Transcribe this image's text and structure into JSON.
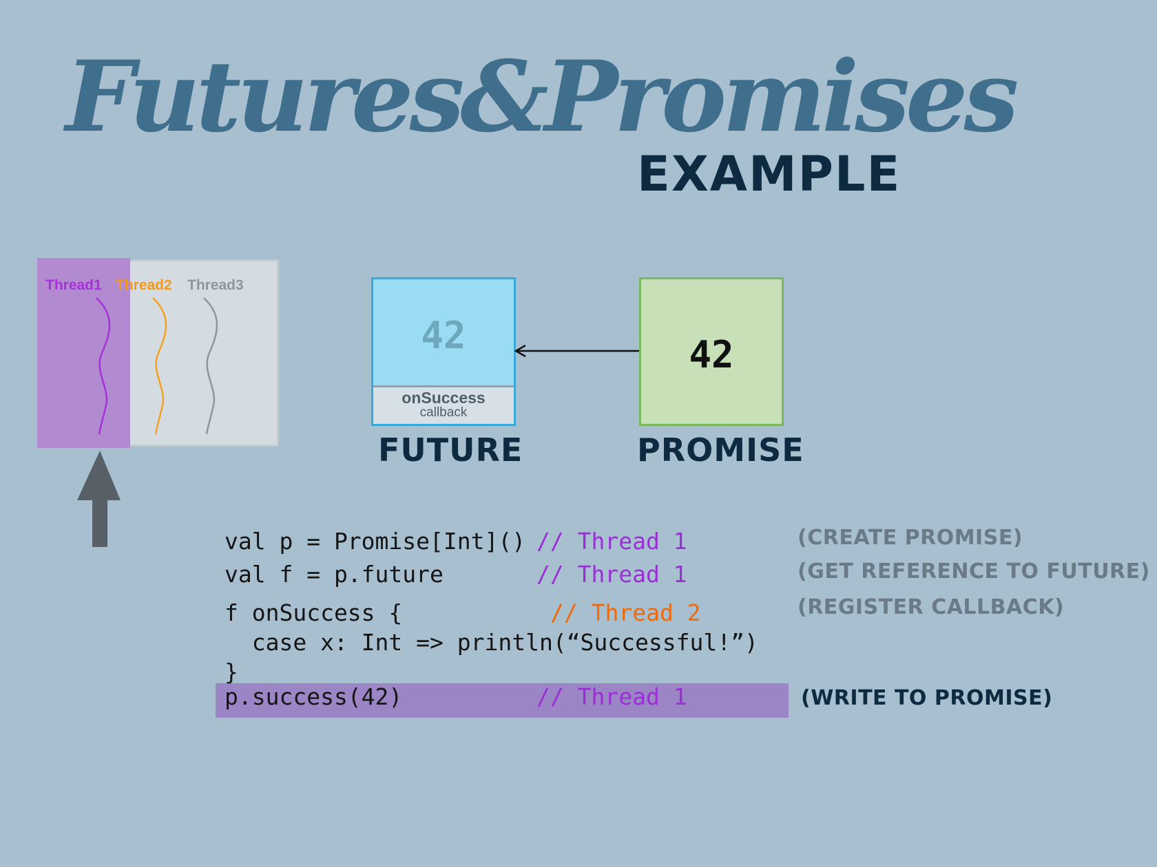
{
  "title": {
    "script": "Futures&Promises",
    "sub": "EXAMPLE"
  },
  "threads": {
    "labels": [
      {
        "text": "Thread1",
        "color": "#a532d8"
      },
      {
        "text": "Thread2",
        "color": "#f39a1a"
      },
      {
        "text": "Thread3",
        "color": "#8e969c"
      }
    ],
    "active": "Thread1"
  },
  "future": {
    "value": "42",
    "callback_main": "onSuccess",
    "callback_sub": "callback",
    "label": "FUTURE"
  },
  "promise": {
    "value": "42",
    "label": "PROMISE"
  },
  "code": {
    "lines": [
      {
        "code": "val p = Promise[Int]()",
        "comment": "// Thread 1"
      },
      {
        "code": "val f = p.future",
        "comment": "// Thread 1"
      },
      {
        "code": "f onSuccess {",
        "comment": "// Thread 2"
      },
      {
        "code": "  case x: Int => println(“Successful!”)",
        "comment": ""
      },
      {
        "code": "}",
        "comment": ""
      },
      {
        "code": "p.success(42)",
        "comment": "// Thread 1"
      }
    ]
  },
  "notes": [
    "(CREATE PROMISE)",
    "(GET REFERENCE TO FUTURE)",
    "(REGISTER CALLBACK)",
    "(WRITE TO PROMISE)"
  ],
  "colors": {
    "background": "#a7bfce",
    "title": "#3f6f8c",
    "future": "#99dcf4",
    "promise": "#c7e0b8",
    "highlight": "#9b85c4"
  }
}
